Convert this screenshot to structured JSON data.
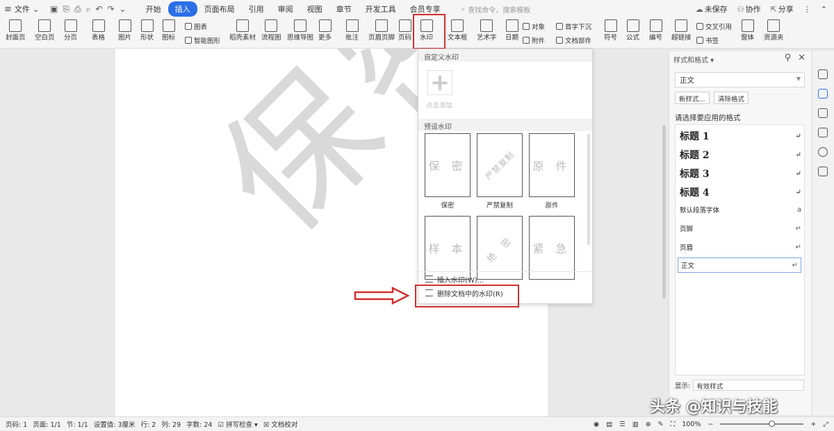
{
  "titlebar": {
    "menu_label": "文件",
    "tabs": [
      "开始",
      "插入",
      "页面布局",
      "引用",
      "审阅",
      "视图",
      "章节",
      "开发工具",
      "会员专享"
    ],
    "active_tab": "插入",
    "search_placeholder": "查找命令、搜索模板",
    "actions": [
      "未保存",
      "协作",
      "分享"
    ]
  },
  "ribbon": {
    "buttons": [
      "封面页",
      "空白页",
      "分页",
      "表格",
      "图片",
      "形状",
      "图标",
      "稻壳素材",
      "流程图",
      "思维导图",
      "更多",
      "批注",
      "页眉页脚",
      "页码",
      "水印",
      "文本框",
      "艺术字",
      "日期",
      "符号",
      "公式",
      "编号",
      "超链接",
      "窗体",
      "资源夹"
    ],
    "small": [
      "图表",
      "智能图形",
      "对象",
      "附件",
      "首字下沉",
      "文档部件",
      "交叉引用",
      "书签"
    ]
  },
  "dropdown": {
    "custom_header": "自定义水印",
    "add_label": "点击添加",
    "preset_header": "预设水印",
    "presets": [
      {
        "text": "保 密",
        "label": "保密"
      },
      {
        "text": "严禁复制",
        "label": "严禁复制"
      },
      {
        "text": "原 件",
        "label": "原件"
      },
      {
        "text": "样 本",
        "label": ""
      },
      {
        "text": "绝 密",
        "label": ""
      },
      {
        "text": "紧 急",
        "label": ""
      }
    ],
    "insert_label": "插入水印(W)...",
    "delete_label": "删除文档中的水印(R)"
  },
  "document": {
    "watermark_text": "保密"
  },
  "pane": {
    "title": "样式和格式",
    "current_style": "正文",
    "new_style_btn": "新样式...",
    "clear_btn": "清除格式",
    "prompt": "请选择要应用的格式",
    "styles": [
      {
        "label": "标题  1",
        "mark": "↵"
      },
      {
        "label": "标题  2",
        "mark": "↵"
      },
      {
        "label": "标题  3",
        "mark": "↵"
      },
      {
        "label": "标题  4",
        "mark": "↵"
      },
      {
        "label": "默认段落字体",
        "mark": "a"
      },
      {
        "label": "页脚",
        "mark": "↵"
      },
      {
        "label": "页眉",
        "mark": "↵"
      },
      {
        "label": "正文",
        "mark": "↵"
      }
    ],
    "show_label": "显示:",
    "show_value": "有效样式"
  },
  "status": {
    "page_num": "页码: 1",
    "pages": "页面: 1/1",
    "section": "节: 1/1",
    "setting": "设置值: 3厘米",
    "row": "行: 2",
    "col": "列: 29",
    "words": "字数: 24",
    "spell": "拼写检查",
    "proof": "文档校对",
    "zoom": "100%"
  },
  "credit": "头条 @知识与技能"
}
